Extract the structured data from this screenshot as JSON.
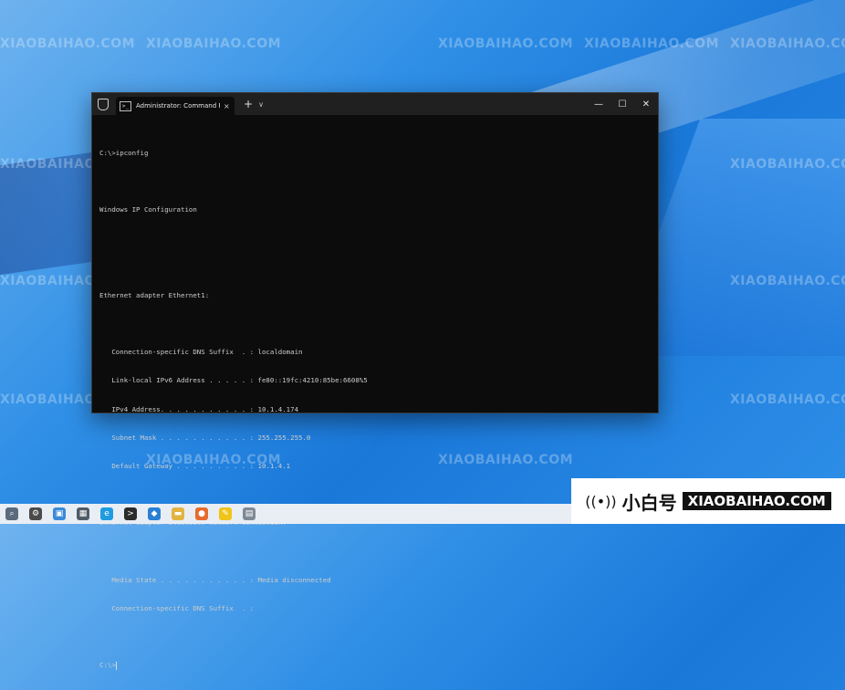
{
  "terminal": {
    "tab_title": "Administrator: Command Prompt",
    "tab_close": "×",
    "new_tab": "+",
    "dropdown": "∨",
    "controls": {
      "minimize": "—",
      "maximize": "☐",
      "close": "✕"
    },
    "lines": [
      "C:\\>ipconfig",
      "",
      "Windows IP Configuration",
      "",
      "",
      "Ethernet adapter Ethernet1:",
      "",
      "   Connection-specific DNS Suffix  . : localdomain",
      "   Link-local IPv6 Address . . . . . : fe80::19fc:4210:85be:6608%5",
      "   IPv4 Address. . . . . . . . . . . : 10.1.4.174",
      "   Subnet Mask . . . . . . . . . . . : 255.255.255.0",
      "   Default Gateway . . . . . . . . . : 10.1.4.1",
      "",
      "Ethernet adapter Bluetooth Network Connection:",
      "",
      "   Media State . . . . . . . . . . . : Media disconnected",
      "   Connection-specific DNS Suffix  . :",
      "",
      "C:\\>"
    ]
  },
  "watermark": {
    "text": "XIAOBAIHAO.COM",
    "cn_text": "@小白号"
  },
  "brand": {
    "cn": "小白号",
    "en": "XIAOBAIHAO.COM"
  },
  "taskbar": {
    "icons": [
      "search-icon",
      "settings-icon",
      "photos-icon",
      "calculator-icon",
      "edge-icon",
      "terminal-icon",
      "vscode-icon",
      "file-explorer-icon",
      "firefox-icon",
      "paint-icon",
      "notepad-icon"
    ]
  }
}
